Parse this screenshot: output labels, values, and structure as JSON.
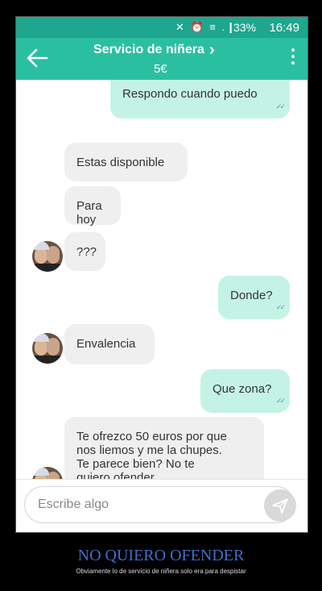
{
  "status": {
    "battery": "33%",
    "time": "16:49",
    "icons": "✕ ⏰ ≡ .❙"
  },
  "header": {
    "title": "Servicio de niñera",
    "price": "5€"
  },
  "messages": [
    {
      "from": "me",
      "text": "Respondo cuando puedo",
      "ticks": "✓✓"
    },
    {
      "from": "them",
      "text": "Estas disponible"
    },
    {
      "from": "them",
      "text": "Para hoy"
    },
    {
      "from": "them",
      "text": "???"
    },
    {
      "from": "me",
      "text": "Donde?",
      "ticks": "✓✓"
    },
    {
      "from": "them",
      "text": "Envalencia"
    },
    {
      "from": "me",
      "text": "Que zona?",
      "ticks": "✓✓"
    },
    {
      "from": "them",
      "lines": [
        "Te ofrezco 50 euros por que",
        "nos liemos y me la chupes.",
        "Te parece bien? No te",
        "quiero ofender"
      ]
    }
  ],
  "composer": {
    "placeholder": "Escribe algo"
  },
  "caption": {
    "title": "NO QUIERO OFENDER",
    "subtitle": "Obviamente lo de servicio de niñera solo era para despistar"
  },
  "colors": {
    "appbar": "#2bbfa2",
    "statusbar": "#1ea68e",
    "outgoing": "#c4f3e6",
    "incoming": "#efefef",
    "caption": "#3d6fcc"
  }
}
